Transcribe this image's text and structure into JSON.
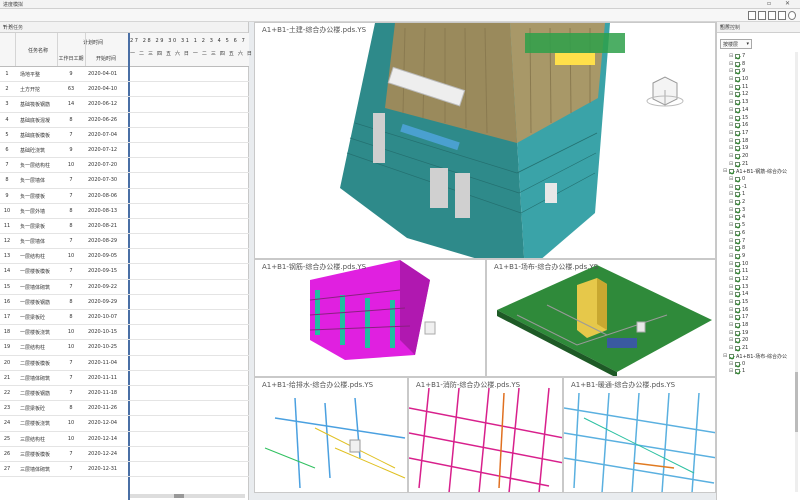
{
  "window": {
    "title": "进度模拟",
    "controls": "▫ ✕"
  },
  "left_panel": {
    "title": "计划任务",
    "controls": "▾ ✕",
    "header": {
      "task_name": "任务名称",
      "group_title": "计划时间",
      "duration": "工作日工期",
      "start": "开始时间"
    },
    "day_numbers": "27 28 29 30 31  1  2  3  4  5  6  7",
    "weekdays": "一 二 三 四 五 六 日 一 二 三 四 五 六 日",
    "rows": [
      {
        "idx": "1",
        "name": "场地平整",
        "dur": "9",
        "start": "2020-04-01"
      },
      {
        "idx": "2",
        "name": "土方开挖",
        "dur": "63",
        "start": "2020-04-10"
      },
      {
        "idx": "3",
        "name": "基础筏板钢筋",
        "dur": "14",
        "start": "2020-06-12"
      },
      {
        "idx": "4",
        "name": "基础底板混凝",
        "dur": "8",
        "start": "2020-06-26"
      },
      {
        "idx": "5",
        "name": "基础底板模板",
        "dur": "7",
        "start": "2020-07-04"
      },
      {
        "idx": "6",
        "name": "基础砼浇筑",
        "dur": "9",
        "start": "2020-07-12"
      },
      {
        "idx": "7",
        "name": "负一层结构柱",
        "dur": "10",
        "start": "2020-07-20"
      },
      {
        "idx": "8",
        "name": "负一层墙体",
        "dur": "7",
        "start": "2020-07-30"
      },
      {
        "idx": "9",
        "name": "负一层楼板",
        "dur": "7",
        "start": "2020-08-06"
      },
      {
        "idx": "10",
        "name": "负一层外墙",
        "dur": "8",
        "start": "2020-08-13"
      },
      {
        "idx": "11",
        "name": "负一层梁板",
        "dur": "8",
        "start": "2020-08-21"
      },
      {
        "idx": "12",
        "name": "负一层墙体",
        "dur": "7",
        "start": "2020-08-29"
      },
      {
        "idx": "13",
        "name": "一层结构柱",
        "dur": "10",
        "start": "2020-09-05"
      },
      {
        "idx": "14",
        "name": "一层楼板模板",
        "dur": "7",
        "start": "2020-09-15"
      },
      {
        "idx": "15",
        "name": "一层墙体砌筑",
        "dur": "7",
        "start": "2020-09-22"
      },
      {
        "idx": "16",
        "name": "一层楼板钢筋",
        "dur": "8",
        "start": "2020-09-29"
      },
      {
        "idx": "17",
        "name": "一层梁板砼",
        "dur": "8",
        "start": "2020-10-07"
      },
      {
        "idx": "18",
        "name": "一层楼板浇筑",
        "dur": "10",
        "start": "2020-10-15"
      },
      {
        "idx": "19",
        "name": "二层结构柱",
        "dur": "10",
        "start": "2020-10-25"
      },
      {
        "idx": "20",
        "name": "二层楼板模板",
        "dur": "7",
        "start": "2020-11-04"
      },
      {
        "idx": "21",
        "name": "二层墙体砌筑",
        "dur": "7",
        "start": "2020-11-11"
      },
      {
        "idx": "22",
        "name": "二层楼板钢筋",
        "dur": "7",
        "start": "2020-11-18"
      },
      {
        "idx": "23",
        "name": "二层梁板砼",
        "dur": "8",
        "start": "2020-11-26"
      },
      {
        "idx": "24",
        "name": "二层楼板浇筑",
        "dur": "10",
        "start": "2020-12-04"
      },
      {
        "idx": "25",
        "name": "三层结构柱",
        "dur": "10",
        "start": "2020-12-14"
      },
      {
        "idx": "26",
        "name": "三层楼板模板",
        "dur": "7",
        "start": "2020-12-24"
      },
      {
        "idx": "27",
        "name": "三层墙体砌筑",
        "dur": "7",
        "start": "2020-12-31"
      }
    ]
  },
  "viewports": {
    "main": {
      "label": "A1+B1-土建-综合办公楼.pds.YS"
    },
    "mid_left": {
      "label": "A1+B1-钢筋-综合办公楼.pds.YS"
    },
    "mid_right": {
      "label": "A1+B1-场布-综合办公楼.pds.YS"
    },
    "bot_1": {
      "label": "A1+B1-给排水-综合办公楼.pds.YS"
    },
    "bot_2": {
      "label": "A1+B1-消防-综合办公楼.pds.YS"
    },
    "bot_3": {
      "label": "A1+B1-暖通-综合办公楼.pds.YS"
    }
  },
  "right_panel": {
    "title": "图层控制",
    "controls": "▾ ✕",
    "dropdown": "按楼层",
    "tree": [
      {
        "level": 2,
        "label": "7"
      },
      {
        "level": 2,
        "label": "8"
      },
      {
        "level": 2,
        "label": "9"
      },
      {
        "level": 2,
        "label": "10"
      },
      {
        "level": 2,
        "label": "11"
      },
      {
        "level": 2,
        "label": "12"
      },
      {
        "level": 2,
        "label": "13"
      },
      {
        "level": 2,
        "label": "14"
      },
      {
        "level": 2,
        "label": "15"
      },
      {
        "level": 2,
        "label": "16"
      },
      {
        "level": 2,
        "label": "17"
      },
      {
        "level": 2,
        "label": "18"
      },
      {
        "level": 2,
        "label": "19"
      },
      {
        "level": 2,
        "label": "20"
      },
      {
        "level": 2,
        "label": "21"
      },
      {
        "level": 1,
        "label": "A1+B1-钢筋-综合办公"
      },
      {
        "level": 2,
        "label": "0"
      },
      {
        "level": 2,
        "label": "-1"
      },
      {
        "level": 2,
        "label": "1"
      },
      {
        "level": 2,
        "label": "2"
      },
      {
        "level": 2,
        "label": "3"
      },
      {
        "level": 2,
        "label": "4"
      },
      {
        "level": 2,
        "label": "5"
      },
      {
        "level": 2,
        "label": "6"
      },
      {
        "level": 2,
        "label": "7"
      },
      {
        "level": 2,
        "label": "8"
      },
      {
        "level": 2,
        "label": "9"
      },
      {
        "level": 2,
        "label": "10"
      },
      {
        "level": 2,
        "label": "11"
      },
      {
        "level": 2,
        "label": "12"
      },
      {
        "level": 2,
        "label": "13"
      },
      {
        "level": 2,
        "label": "14"
      },
      {
        "level": 2,
        "label": "15"
      },
      {
        "level": 2,
        "label": "16"
      },
      {
        "level": 2,
        "label": "17"
      },
      {
        "level": 2,
        "label": "18"
      },
      {
        "level": 2,
        "label": "19"
      },
      {
        "level": 2,
        "label": "20"
      },
      {
        "level": 2,
        "label": "21"
      },
      {
        "level": 1,
        "label": "A1+B1-场布-综合办公"
      },
      {
        "level": 2,
        "label": "0"
      },
      {
        "level": 2,
        "label": "1"
      }
    ]
  },
  "colors": {
    "accent": "#4a6fa5",
    "rebar": "#e020e0",
    "fire_pipe": "#d8208c",
    "hvac": "#5ab0e0",
    "check": "#2d8a2d"
  }
}
